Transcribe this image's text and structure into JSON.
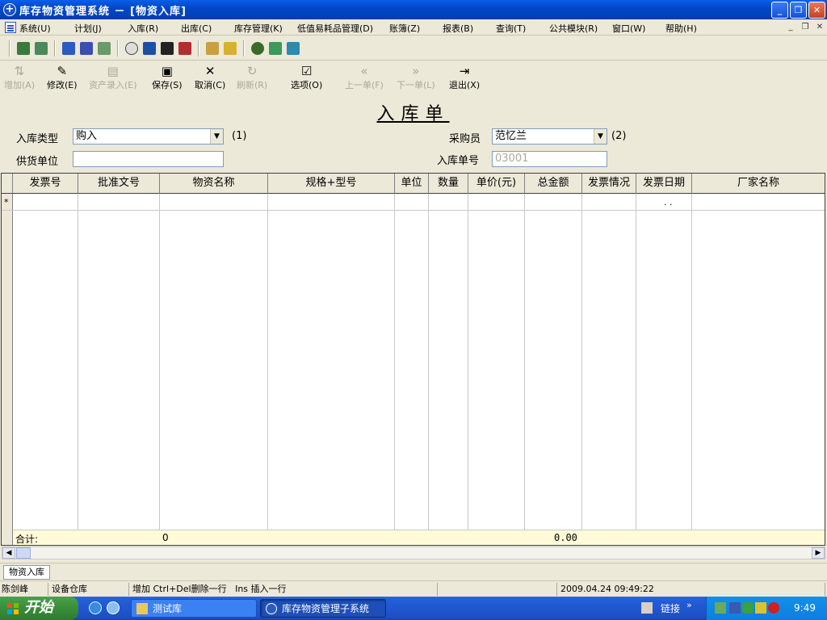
{
  "window": {
    "title": "库存物资管理系统 － [物资入库]"
  },
  "menubar": {
    "items": [
      "系统(U)",
      "计划(J)",
      "入库(R)",
      "出库(C)",
      "库存管理(K)",
      "低值易耗品管理(D)",
      "账簿(Z)",
      "报表(B)",
      "查询(T)",
      "公共模块(R)",
      "窗口(W)",
      "帮助(H)"
    ]
  },
  "toolbar": {
    "add": "增加(A)",
    "edit": "修改(E)",
    "asset_entry": "资产录入(E)",
    "save": "保存(S)",
    "cancel": "取消(C)",
    "refresh": "刷新(R)",
    "options": "选项(O)",
    "prev": "上一单(F)",
    "next": "下一单(L)",
    "exit": "退出(X)"
  },
  "form": {
    "title": "入库单",
    "type_label": "入库类型",
    "type_value": "购入",
    "type_hint": "(1)",
    "supplier_label": "供货单位",
    "supplier_value": "",
    "buyer_label": "采购员",
    "buyer_value": "范忆兰",
    "buyer_hint": "(2)",
    "number_label": "入库单号",
    "number_value": "03001"
  },
  "grid": {
    "columns": [
      "发票号",
      "批准文号",
      "物资名称",
      "规格+型号",
      "单位",
      "数量",
      "单价(元)",
      "总金额",
      "发票情况",
      "发票日期",
      "厂家名称"
    ],
    "new_row_marker": "*",
    "new_row_date": ".  .",
    "summary": {
      "label": "合计:",
      "name_total": "0",
      "amount_total": "0.00"
    }
  },
  "tabs": [
    "物资入库"
  ],
  "status": {
    "user": "陈剑峰",
    "location": "设备仓库",
    "hint": "增加 Ctrl+Del删除一行   Ins 插入一行",
    "datetime": "2009.04.24 09:49:22"
  },
  "taskbar": {
    "start": "开始",
    "tasks": [
      "测试库",
      "库存物资管理子系统"
    ],
    "links": "链接",
    "time": "9:49"
  }
}
